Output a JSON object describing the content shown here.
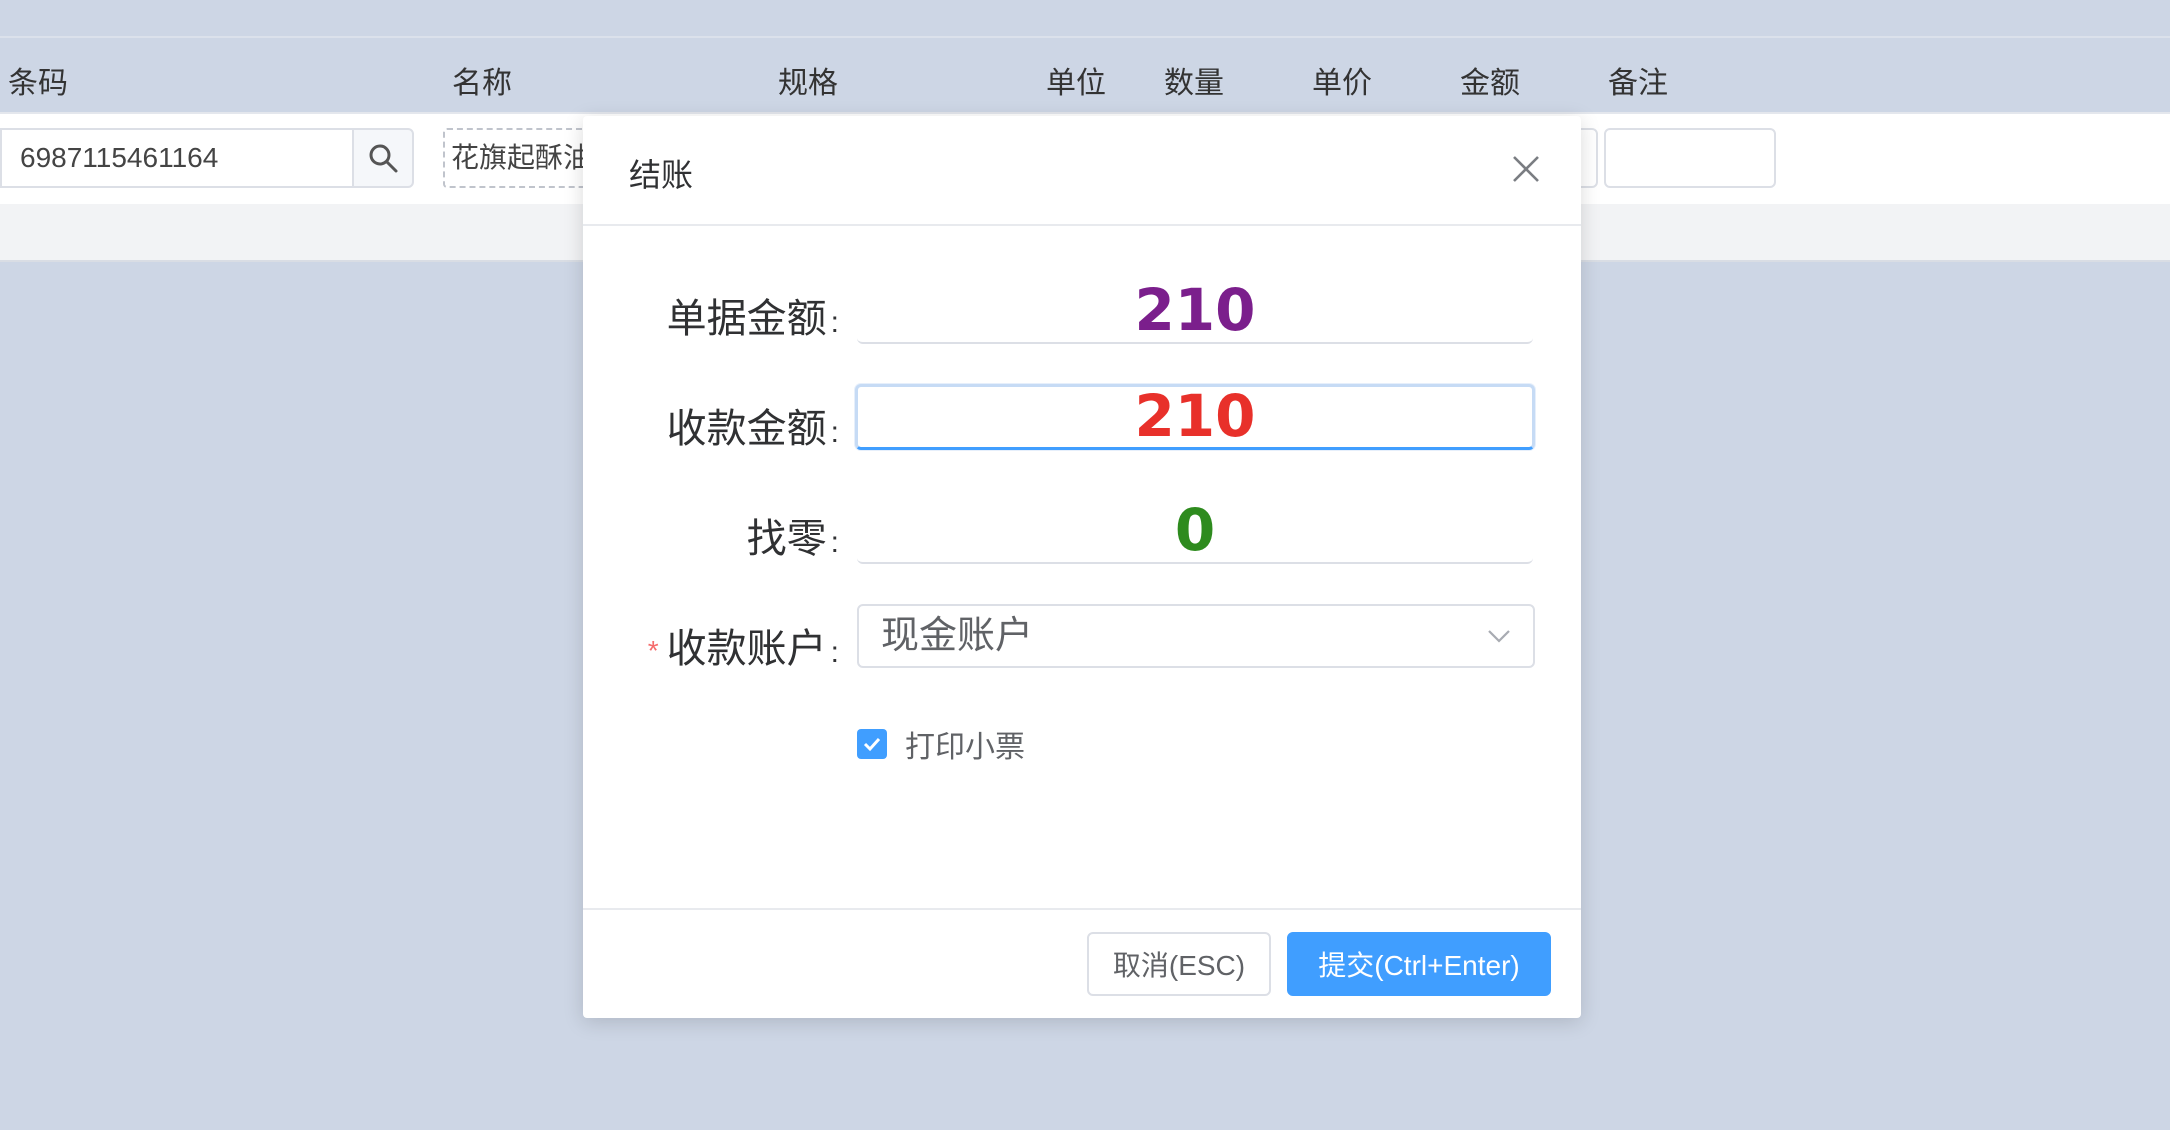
{
  "table": {
    "headers": {
      "barcode": "条码",
      "name": "名称",
      "spec": "规格",
      "unit": "单位",
      "quantity": "数量",
      "price": "单价",
      "amount": "金额",
      "remark": "备注"
    },
    "row": {
      "barcode": "6987115461164",
      "name": "花旗起酥油"
    }
  },
  "dialog": {
    "title": "结账",
    "fields": {
      "bill_amount": {
        "label": "单据金额",
        "value": "210"
      },
      "received_amount": {
        "label": "收款金额",
        "value": "210"
      },
      "change": {
        "label": "找零",
        "value": "0"
      },
      "account": {
        "label": "收款账户",
        "value": "现金账户",
        "required_mark": "*"
      }
    },
    "colon": ":",
    "print_receipt": {
      "label": "打印小票",
      "checked": true
    },
    "buttons": {
      "cancel": "取消(ESC)",
      "submit": "提交(Ctrl+Enter)"
    }
  },
  "colors": {
    "bill_amount": "#7b1f8c",
    "received_amount": "#e8302a",
    "change": "#2e8b1e",
    "primary": "#409eff",
    "required": "#f56c6c"
  },
  "icons": {
    "search": "search-icon",
    "close": "close-icon",
    "dropdown": "chevron-down-icon",
    "check": "check-icon"
  }
}
